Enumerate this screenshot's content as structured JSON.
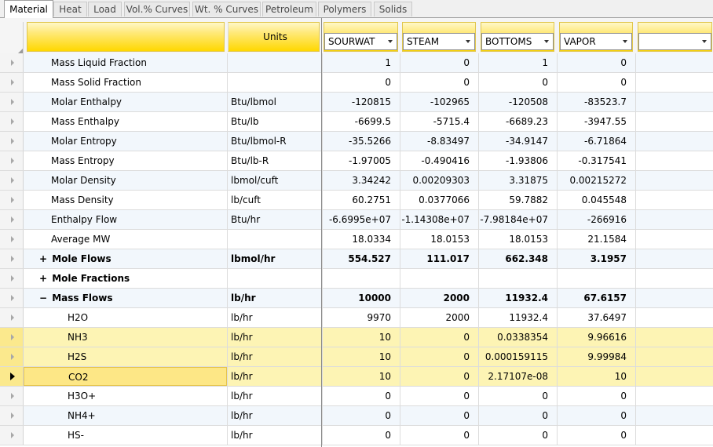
{
  "tabs": [
    {
      "label": "Material",
      "active": true
    },
    {
      "label": "Heat"
    },
    {
      "label": "Load"
    },
    {
      "label": "Vol.% Curves"
    },
    {
      "label": "Wt. % Curves"
    },
    {
      "label": "Petroleum"
    },
    {
      "label": "Polymers"
    },
    {
      "label": "Solids"
    }
  ],
  "header": {
    "units_label": "Units",
    "streams": [
      "SOURWAT",
      "STEAM",
      "BOTTOMS",
      "VAPOR",
      ""
    ]
  },
  "rows": [
    {
      "name": "Mass Liquid Fraction",
      "units": "",
      "values": [
        "1",
        "0",
        "1",
        "0"
      ]
    },
    {
      "name": "Mass Solid Fraction",
      "units": "",
      "values": [
        "0",
        "0",
        "0",
        "0"
      ]
    },
    {
      "name": "Molar Enthalpy",
      "units": "Btu/lbmol",
      "values": [
        "-120815",
        "-102965",
        "-120508",
        "-83523.7"
      ]
    },
    {
      "name": "Mass Enthalpy",
      "units": "Btu/lb",
      "values": [
        "-6699.5",
        "-5715.4",
        "-6689.23",
        "-3947.55"
      ]
    },
    {
      "name": "Molar Entropy",
      "units": "Btu/lbmol-R",
      "values": [
        "-35.5266",
        "-8.83497",
        "-34.9147",
        "-6.71864"
      ]
    },
    {
      "name": "Mass Entropy",
      "units": "Btu/lb-R",
      "values": [
        "-1.97005",
        "-0.490416",
        "-1.93806",
        "-0.317541"
      ]
    },
    {
      "name": "Molar Density",
      "units": "lbmol/cuft",
      "values": [
        "3.34242",
        "0.00209303",
        "3.31875",
        "0.00215272"
      ]
    },
    {
      "name": "Mass Density",
      "units": "lb/cuft",
      "values": [
        "60.2751",
        "0.0377066",
        "59.7882",
        "0.045548"
      ]
    },
    {
      "name": "Enthalpy Flow",
      "units": "Btu/hr",
      "values": [
        "-6.6995e+07",
        "-1.14308e+07",
        "-7.98184e+07",
        "-266916"
      ]
    },
    {
      "name": "Average MW",
      "units": "",
      "values": [
        "18.0334",
        "18.0153",
        "18.0153",
        "21.1584"
      ]
    },
    {
      "name": "Mole Flows",
      "units": "lbmol/hr",
      "values": [
        "554.527",
        "111.017",
        "662.348",
        "3.1957"
      ],
      "bold": true,
      "expander": "+"
    },
    {
      "name": "Mole Fractions",
      "units": "",
      "values": [
        "",
        "",
        "",
        ""
      ],
      "bold": true,
      "expander": "+"
    },
    {
      "name": "Mass Flows",
      "units": "lb/hr",
      "values": [
        "10000",
        "2000",
        "11932.4",
        "67.6157"
      ],
      "bold": true,
      "expander": "−"
    },
    {
      "name": "H2O",
      "units": "lb/hr",
      "values": [
        "9970",
        "2000",
        "11932.4",
        "37.6497"
      ],
      "indent": true
    },
    {
      "name": "NH3",
      "units": "lb/hr",
      "values": [
        "10",
        "0",
        "0.0338354",
        "9.96616"
      ],
      "indent": true,
      "selected": true
    },
    {
      "name": "H2S",
      "units": "lb/hr",
      "values": [
        "10",
        "0",
        "0.000159115",
        "9.99984"
      ],
      "indent": true,
      "selected": true
    },
    {
      "name": "CO2",
      "units": "lb/hr",
      "values": [
        "10",
        "0",
        "2.17107e-08",
        "10"
      ],
      "indent": true,
      "selected": true,
      "current": true
    },
    {
      "name": "H3O+",
      "units": "lb/hr",
      "values": [
        "0",
        "0",
        "0",
        "0"
      ],
      "indent": true
    },
    {
      "name": "NH4+",
      "units": "lb/hr",
      "values": [
        "0",
        "0",
        "0",
        "0"
      ],
      "indent": true
    },
    {
      "name": "HS-",
      "units": "lb/hr",
      "values": [
        "0",
        "0",
        "0",
        "0"
      ],
      "indent": true
    }
  ]
}
